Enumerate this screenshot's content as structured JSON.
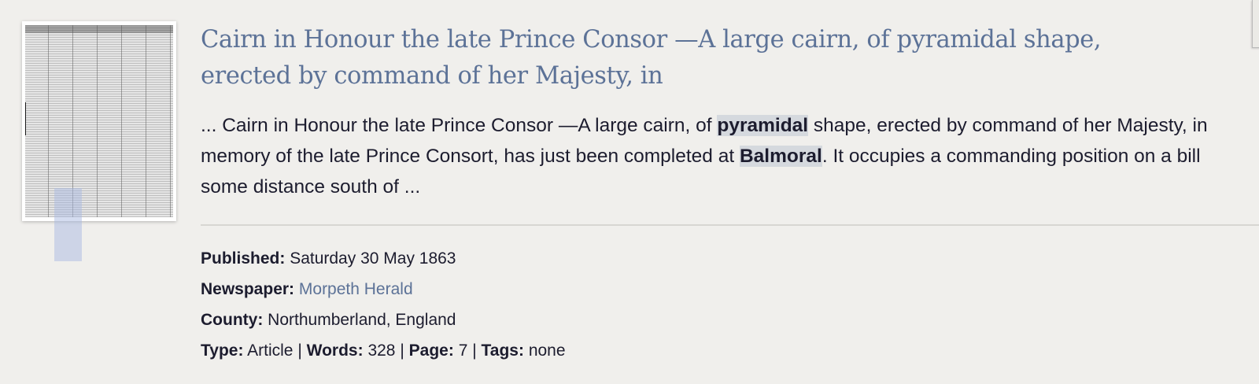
{
  "result": {
    "title": "Cairn in Honour the late Prince Consor —A large cairn, of pyramidal shape, erected by command of her Majesty, in",
    "snippet": {
      "part1": "... Cairn in Honour the late Prince Consor —A large cairn, of ",
      "highlight1": "pyramidal",
      "part2": " shape, erected by command of her Majesty, in memory of the late Prince Consort, has just been completed at ",
      "highlight2": "Balmoral",
      "part3": ". It occupies a commanding position on a bill some distance south of ..."
    },
    "meta": {
      "published_label": "Published:",
      "published_value": "Saturday 30 May 1863",
      "newspaper_label": "Newspaper:",
      "newspaper_value": "Morpeth Herald",
      "county_label": "County:",
      "county_value": "Northumberland, England",
      "type_label": "Type:",
      "type_value": "Article",
      "words_label": "Words:",
      "words_value": "328",
      "page_label": "Page:",
      "page_value": "7",
      "tags_label": "Tags:",
      "tags_value": "none",
      "separator": "|"
    }
  },
  "icons": {
    "thumbnail": "newspaper-page-thumbnail"
  },
  "colors": {
    "background": "#f0efec",
    "link": "#5c7297",
    "text": "#1c1c2e",
    "highlight": "#d5d9de"
  }
}
